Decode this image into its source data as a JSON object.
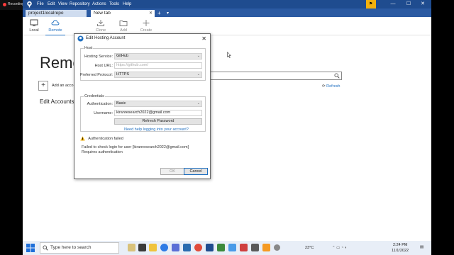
{
  "recording": {
    "label": "Recording..."
  },
  "menubar": {
    "items": [
      "File",
      "Edit",
      "View",
      "Repository",
      "Actions",
      "Tools",
      "Help"
    ],
    "window_controls": [
      "—",
      "☐",
      "✕"
    ]
  },
  "tabs": [
    {
      "label": "project1localrepo"
    },
    {
      "label": "New tab"
    }
  ],
  "toolbar": {
    "local": "Local",
    "remote": "Remote",
    "clone": "Clone",
    "add": "Add",
    "create": "Create"
  },
  "main": {
    "title": "Remo",
    "add_account_label": "Add an acco",
    "refresh": "Refresh",
    "edit_accounts": "Edit Accounts..."
  },
  "dialog": {
    "title": "Edit Hosting Account",
    "host_group": "Host",
    "hosting_service_label": "Hosting Service:",
    "hosting_service_value": "GitHub",
    "host_url_label": "Host URL:",
    "host_url_placeholder": "https://github.com/",
    "preferred_protocol_label": "Preferred Protocol:",
    "preferred_protocol_value": "HTTPS",
    "credentials_group": "Credentials",
    "authentication_label": "Authentication:",
    "authentication_value": "Basic",
    "username_label": "Username:",
    "username_value": "kiranresearch2022@gmail.com",
    "refresh_password": "Refresh Password",
    "help_link": "Need help logging into your account?",
    "auth_failed": "Authentication failed",
    "error_line1": "Failed to check login for user [kiranresearch2022@gmail.com]",
    "error_line2": "Requires authentication",
    "ok": "OK",
    "cancel": "Cancel"
  },
  "taskbar": {
    "search_placeholder": "Type here to search",
    "temperature": "23°C",
    "time": "2:24 PM",
    "date": "11/1/2022"
  }
}
